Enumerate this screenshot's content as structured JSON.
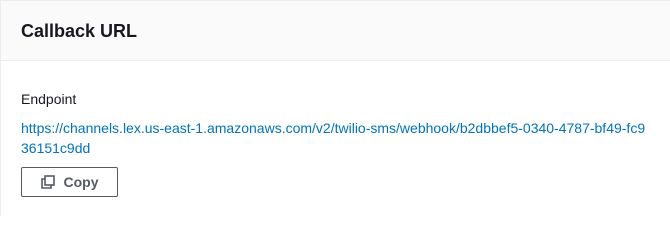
{
  "panel": {
    "title": "Callback URL"
  },
  "endpoint": {
    "label": "Endpoint",
    "url": "https://channels.lex.us-east-1.amazonaws.com/v2/twilio-sms/webhook/b2dbbef5-0340-4787-bf49-fc936151c9dd"
  },
  "copy_button": {
    "label": "Copy",
    "icon": "copy-icon"
  },
  "colors": {
    "link": "#0073bb",
    "header_bg": "#fafafa",
    "border": "#eaeded",
    "button_border": "#545b64"
  }
}
